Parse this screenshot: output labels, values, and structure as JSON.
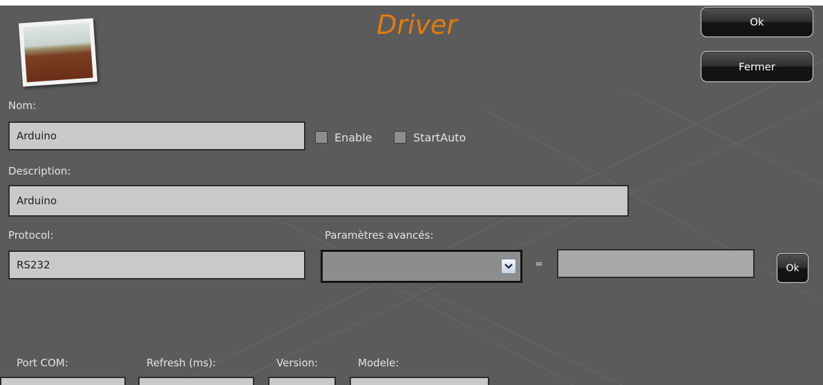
{
  "window": {
    "title": "Driver"
  },
  "buttons": {
    "ok": "Ok",
    "close": "Fermer",
    "param_ok": "Ok"
  },
  "name": {
    "label": "Nom:",
    "value": "Arduino"
  },
  "checkboxes": {
    "enable": "Enable",
    "start_auto": "StartAuto"
  },
  "description": {
    "label": "Description:",
    "value": "Arduino"
  },
  "protocol": {
    "label": "Protocol:",
    "value": "RS232"
  },
  "advanced": {
    "label": "Paramètres avancés:",
    "selected": "",
    "equals": "=",
    "value": ""
  },
  "bottom_fields": {
    "port_com": "Port COM:",
    "refresh": "Refresh (ms):",
    "version": "Version:",
    "modele": "Modele:"
  },
  "colors": {
    "title": "#e37b0f",
    "panel": "#5b5b5b",
    "field": "#c9c9c9"
  },
  "icons": {
    "driver_image": "photo-icon",
    "combo_arrow": "chevron-down-icon"
  }
}
